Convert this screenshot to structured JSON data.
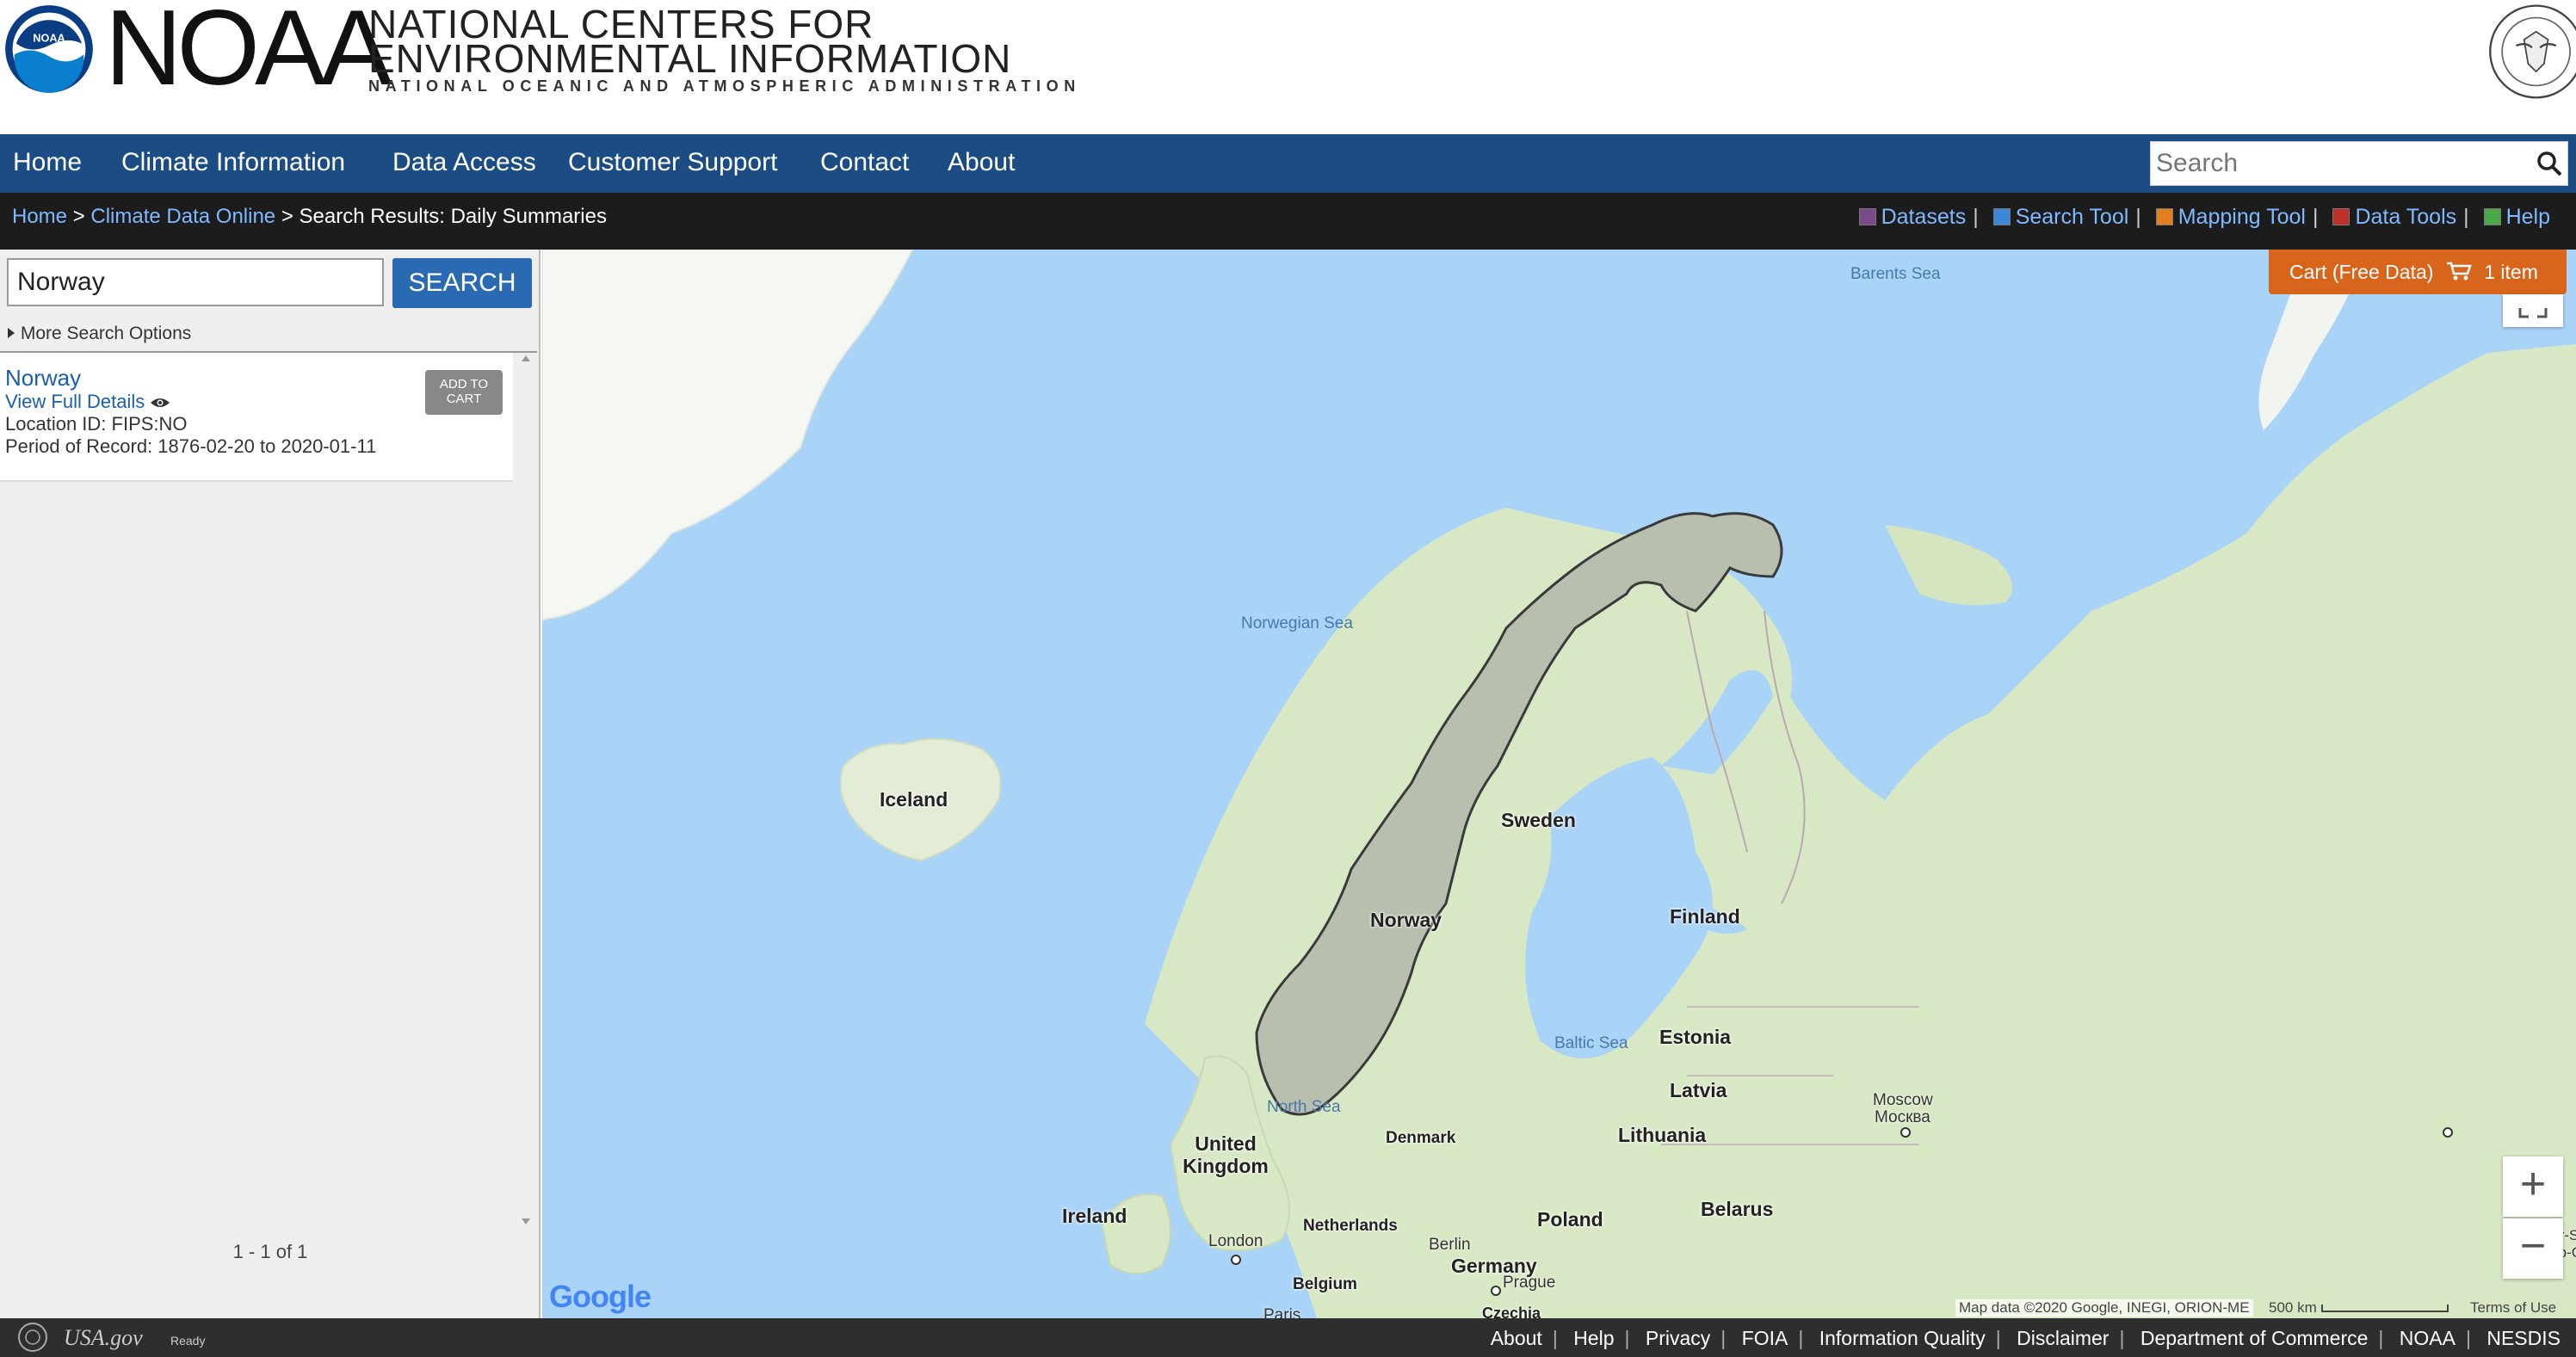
{
  "header": {
    "brand": "NOAA",
    "title_line1": "NATIONAL CENTERS FOR",
    "title_line2": "ENVIRONMENTAL INFORMATION",
    "title_line3": "NATIONAL OCEANIC AND ATMOSPHERIC ADMINISTRATION"
  },
  "nav": {
    "items": [
      "Home",
      "Climate Information",
      "Data Access",
      "Customer Support",
      "Contact",
      "About"
    ],
    "search_placeholder": "Search"
  },
  "breadcrumb": {
    "home": "Home",
    "sep1": ">",
    "cdo": "Climate Data Online",
    "sep2": ">",
    "current": "Search Results: Daily Summaries"
  },
  "tools": {
    "datasets": "Datasets",
    "search_tool": "Search Tool",
    "mapping_tool": "Mapping Tool",
    "data_tools": "Data Tools",
    "help": "Help",
    "sep": "|"
  },
  "search": {
    "value": "Norway",
    "button": "SEARCH",
    "more_options": "More Search Options"
  },
  "result": {
    "name": "Norway",
    "details_link": "View Full Details",
    "location_id": "Location ID: FIPS:NO",
    "period": "Period of Record:  1876-02-20 to 2020-01-11",
    "add_to_cart_line1": "ADD TO",
    "add_to_cart_line2": "CART"
  },
  "pager": "1 - 1 of 1",
  "cart": {
    "label": "Cart (Free Data)",
    "count": "1 item"
  },
  "map": {
    "seas": {
      "barents": "Barents Sea",
      "norwegian": "Norwegian Sea",
      "north": "North Sea",
      "baltic": "Baltic Sea"
    },
    "countries": {
      "iceland": "Iceland",
      "sweden": "Sweden",
      "norway": "Norway",
      "finland": "Finland",
      "estonia": "Estonia",
      "latvia": "Latvia",
      "lithuania": "Lithuania",
      "denmark": "Denmark",
      "uk": "United Kingdom",
      "ireland": "Ireland",
      "netherlands": "Netherlands",
      "belgium": "Belgium",
      "germany": "Germany",
      "poland": "Poland",
      "belarus": "Belarus",
      "czechia": "Czechia"
    },
    "cities": {
      "moscow_en": "Moscow",
      "moscow_ru": "Москва",
      "london": "London",
      "berlin": "Berlin",
      "prague": "Prague",
      "paris": "Paris",
      "nur_line1": "Nur-S",
      "nur_line2": "Нур-С"
    },
    "google": "Google",
    "attribution": "Map data ©2020 Google, INEGI, ORION-ME",
    "scale": "500 km",
    "terms": "Terms of Use",
    "zoom_in": "+",
    "zoom_out": "−"
  },
  "footer": {
    "usagov": "USA.gov",
    "ready": "Ready",
    "links": [
      "About",
      "Help",
      "Privacy",
      "FOIA",
      "Information Quality",
      "Disclaimer",
      "Department of Commerce",
      "NOAA",
      "NESDIS"
    ]
  },
  "colors": {
    "nav_bg": "#1b4d84",
    "crumb_bg": "#1c1c1c",
    "link": "#7fb9ff",
    "cart_bg": "#d8651c",
    "search_btn": "#2a6ab3",
    "water": "#aad3f8",
    "land": "#d9e8c4",
    "footer_bg": "#2e2e2e"
  }
}
